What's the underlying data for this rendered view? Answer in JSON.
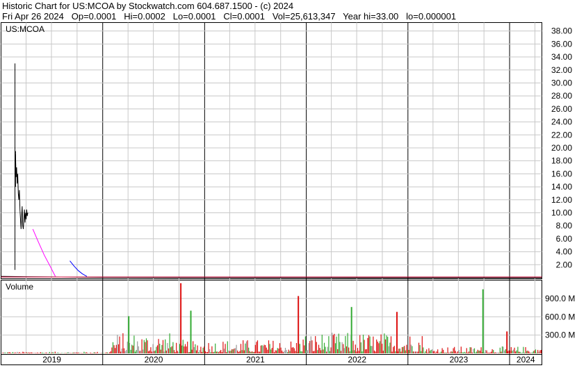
{
  "header": {
    "line1": "Historic Chart for US:MCOA by Stockwatch.com 604.687.1500 - (c) 2024",
    "line2": "Fri Apr 26 2024   Op=0.0001   Hi=0.0002   Lo=0.0001   Cl=0.0001   Vol=25,613,347   Year hi=33.00   lo=0.000001"
  },
  "chart_data": [
    {
      "type": "line",
      "title": "US:MCOA",
      "x_range": [
        "2019-01-01",
        "2024-04-26"
      ],
      "ylim": [
        0,
        39.3
      ],
      "y_ticks": [
        "38.00",
        "36.00",
        "34.00",
        "32.00",
        "30.00",
        "28.00",
        "26.00",
        "24.00",
        "22.00",
        "20.00",
        "18.00",
        "16.00",
        "14.00",
        "12.00",
        "10.00",
        "8.00",
        "6.00",
        "4.00",
        "2.00"
      ],
      "grid": true,
      "series": [
        {
          "color": "#000000",
          "x": [
            "2019-02-20",
            "2019-02-22",
            "2019-02-24",
            "2019-02-26",
            "2019-02-28",
            "2019-03-02",
            "2019-03-04",
            "2019-03-06",
            "2019-03-08",
            "2019-03-10",
            "2019-03-12",
            "2019-03-14",
            "2019-03-16",
            "2019-03-18",
            "2019-03-20",
            "2019-03-22",
            "2019-03-24",
            "2019-03-26",
            "2019-03-28",
            "2019-03-30",
            "2019-04-01",
            "2019-04-03",
            "2019-04-05",
            "2019-04-07"
          ],
          "values": [
            14.0,
            19.0,
            15.5,
            17.0,
            14.5,
            16.0,
            13.0,
            12.0,
            13.5,
            10.5,
            9.0,
            7.5,
            9.5,
            11.0,
            8.0,
            7.5,
            9.0,
            10.5,
            8.5,
            10.0,
            9.0,
            10.5,
            9.5,
            10.0
          ]
        },
        {
          "color": "#ff00ff",
          "x": [
            "2019-04-25",
            "2019-05-15",
            "2019-06-05",
            "2019-06-26",
            "2019-07-15"
          ],
          "values": [
            7.5,
            5.5,
            3.5,
            1.8,
            0.2
          ]
        },
        {
          "color": "#0000ff",
          "x": [
            "2019-09-05",
            "2019-09-20",
            "2019-10-05",
            "2019-10-20",
            "2019-11-05"
          ],
          "values": [
            2.6,
            1.8,
            1.1,
            0.6,
            0.2
          ]
        },
        {
          "color": "#000000",
          "x": [
            "2019-01-01",
            "2019-04-01",
            "2019-07-01",
            "2020-01-01",
            "2021-01-01",
            "2022-01-01",
            "2023-01-01",
            "2024-01-01",
            "2024-04-26"
          ],
          "values": [
            0.2,
            0.15,
            0.12,
            0.05,
            0.02,
            0.01,
            0.005,
            0.001,
            0.0001
          ]
        }
      ],
      "wicks": [
        {
          "x": "2019-02-20",
          "low": 1.2,
          "high": 33.0
        },
        {
          "x": "2019-02-22",
          "low": 14.0,
          "high": 19.5
        }
      ]
    },
    {
      "type": "bar",
      "title": "Volume",
      "x_categories": [
        "2019",
        "2020",
        "2021",
        "2022",
        "2023",
        "2024"
      ],
      "ylim": [
        0,
        1200000000
      ],
      "y_ticks": [
        "900.0 M",
        "600.0 M",
        "300.0 M"
      ],
      "colors": {
        "up": "#33aa33",
        "down": "#dd1111",
        "flat": "#999999"
      },
      "notable_bars": [
        {
          "x": "2020-04-01",
          "value": 610000000
        },
        {
          "x": "2020-10-05",
          "value": 1150000000
        },
        {
          "x": "2020-11-10",
          "value": 700000000
        },
        {
          "x": "2021-12-01",
          "value": 940000000
        },
        {
          "x": "2022-06-10",
          "value": 760000000
        },
        {
          "x": "2022-11-20",
          "value": 680000000
        },
        {
          "x": "2023-09-25",
          "value": 1050000000
        },
        {
          "x": "2023-12-20",
          "value": 360000000
        }
      ]
    }
  ]
}
